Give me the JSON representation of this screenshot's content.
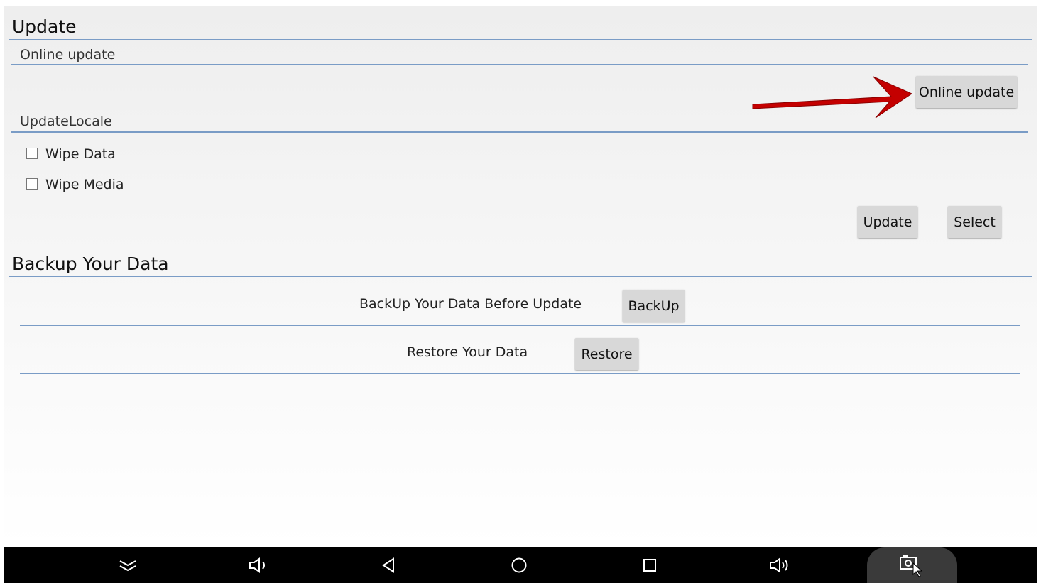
{
  "update": {
    "title": "Update",
    "online_section": "Online update",
    "online_button": "Online update",
    "locale_section": "UpdateLocale",
    "wipe_data": "Wipe Data",
    "wipe_media": "Wipe Media",
    "update_button": "Update",
    "select_button": "Select"
  },
  "backup": {
    "title": "Backup Your Data",
    "backup_label": "BackUp Your Data Before Update",
    "backup_button": "BackUp",
    "restore_label": "Restore Your Data",
    "restore_button": "Restore"
  },
  "navbar": {
    "icons": [
      "chevron-double-down-icon",
      "volume-down-icon",
      "back-icon",
      "home-icon",
      "recents-icon",
      "volume-up-icon",
      "screenshot-icon"
    ]
  },
  "colors": {
    "divider": "#7a9cc6",
    "arrow": "#c40000",
    "button": "#d8d8d8"
  }
}
